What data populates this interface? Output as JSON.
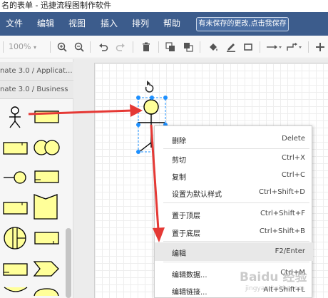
{
  "window": {
    "title": "名的表单 - 迅捷流程图制作软件"
  },
  "menu": {
    "items": [
      {
        "label": "文件"
      },
      {
        "label": "编辑"
      },
      {
        "label": "视图"
      },
      {
        "label": "插入"
      },
      {
        "label": "排列"
      },
      {
        "label": "帮助"
      }
    ],
    "unsaved_notice": "有未保存的更改,点击我保存"
  },
  "toolbar": {
    "zoom": "100%"
  },
  "sidebar": {
    "sections": [
      {
        "title": "nate 3.0 / Applicat..."
      },
      {
        "title": "nate 3.0 / Business"
      }
    ]
  },
  "context_menu": {
    "items": [
      {
        "label": "删除",
        "shortcut": "Delete"
      },
      {
        "label": "剪切",
        "shortcut": "Ctrl+X"
      },
      {
        "label": "复制",
        "shortcut": "Ctrl+C"
      },
      {
        "label": "设置为默认样式",
        "shortcut": "Ctrl+Shift+D"
      },
      {
        "label": "置于顶层",
        "shortcut": "Ctrl+Shift+F"
      },
      {
        "label": "置于底层",
        "shortcut": "Ctrl+Shift+B"
      },
      {
        "label": "编辑",
        "shortcut": "F2/Enter"
      },
      {
        "label": "编辑数据...",
        "shortcut": "Ctrl+M"
      },
      {
        "label": "编辑链接...",
        "shortcut": "Alt+Shift+L"
      }
    ]
  },
  "watermark": {
    "text": "Baidu 经验",
    "subtext": "jingyan.baidu.com"
  },
  "colors": {
    "menubar": "#3c5c8c",
    "shape_fill": "#ffff99",
    "selection": "#1e90ff",
    "arrow": "#e53935"
  }
}
